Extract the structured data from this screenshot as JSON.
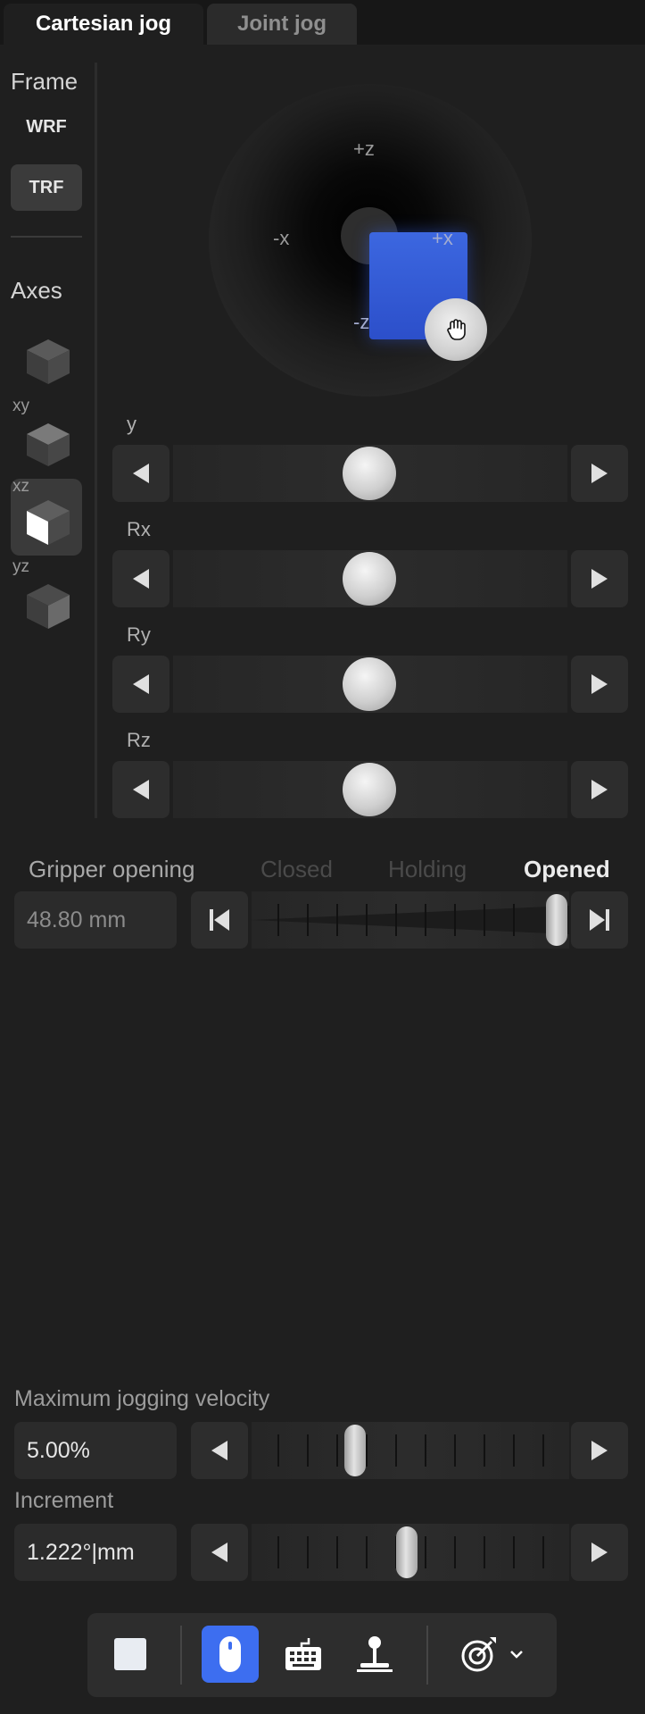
{
  "tabs": [
    {
      "label": "Cartesian jog",
      "active": true
    },
    {
      "label": "Joint jog",
      "active": false
    }
  ],
  "frame": {
    "title": "Frame",
    "options": [
      {
        "label": "WRF",
        "selected": false
      },
      {
        "label": "TRF",
        "selected": true
      }
    ]
  },
  "axes": {
    "title": "Axes",
    "items": [
      {
        "tag": "",
        "icon": "cube-icon",
        "selected": false
      },
      {
        "tag": "xy",
        "icon": "cube-xy-icon",
        "selected": false
      },
      {
        "tag": "xz",
        "icon": "cube-xz-icon",
        "selected": true
      },
      {
        "tag": "yz",
        "icon": "cube-yz-icon",
        "selected": false
      }
    ]
  },
  "joystick": {
    "labels": {
      "pz": "+z",
      "mz": "-z",
      "px": "+x",
      "mx": "-x"
    },
    "handle_icon": "hand-cursor-icon",
    "accent_color": "#3457d5"
  },
  "sliders": [
    {
      "label": "y",
      "value": 0.0
    },
    {
      "label": "Rx",
      "value": 0.0
    },
    {
      "label": "Ry",
      "value": 0.0
    },
    {
      "label": "Rz",
      "value": 0.0
    }
  ],
  "gripper": {
    "title": "Gripper opening",
    "states": [
      {
        "label": "Closed",
        "active": false
      },
      {
        "label": "Holding",
        "active": false
      },
      {
        "label": "Opened",
        "active": true
      }
    ],
    "value": "48.80 mm",
    "level": 1.0
  },
  "velocity": {
    "title": "Maximum jogging velocity",
    "value": "5.00%",
    "level": 0.28
  },
  "increment": {
    "title": "Increment",
    "value": "1.222°|mm",
    "level": 0.42
  },
  "toolbar": {
    "items": [
      "stop-icon",
      "mouse-icon",
      "keyboard-icon",
      "joystick-icon",
      "target-icon",
      "chevron-down-icon"
    ],
    "active_color": "#3d6ef0"
  }
}
